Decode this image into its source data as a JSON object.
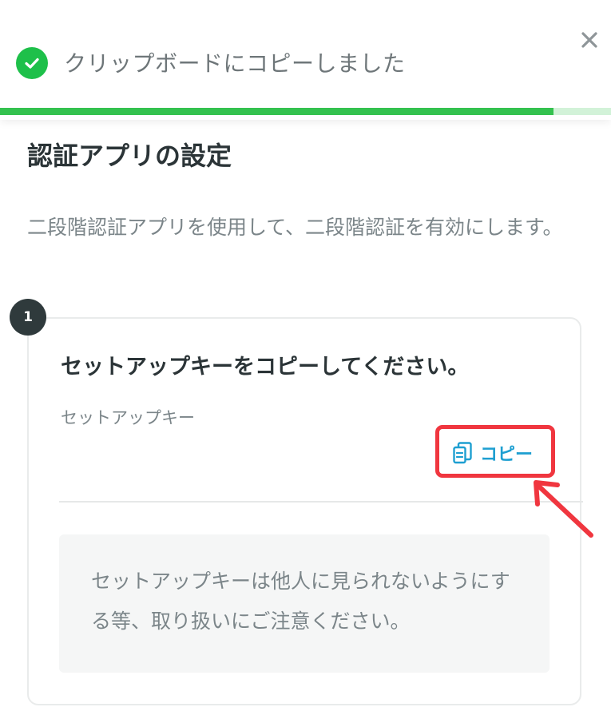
{
  "toast": {
    "message": "クリップボードにコピーしました",
    "progress": 0.906,
    "colors": {
      "success": "#1ec04a",
      "progress_fill": "#34c24f",
      "progress_track": "#d2f2d8"
    },
    "icons": {
      "status": "check-circle-icon",
      "close": "close-icon"
    }
  },
  "page": {
    "title": "認証アプリの設定",
    "description": "二段階認証アプリを使用して、二段階認証を有効にします。"
  },
  "step": {
    "number": "1",
    "title": "セットアップキーをコピーしてください。",
    "key_label": "セットアップキー",
    "copy_button_label": "コピー",
    "copy_icon": "copy-icon",
    "notice": "セットアップキーは他人に見られないようにする等、取り扱いにご注意ください。"
  },
  "colors": {
    "text_primary": "#2b3437",
    "text_secondary": "#7b8589",
    "link": "#1e9fd1",
    "highlight": "#f0363f"
  }
}
